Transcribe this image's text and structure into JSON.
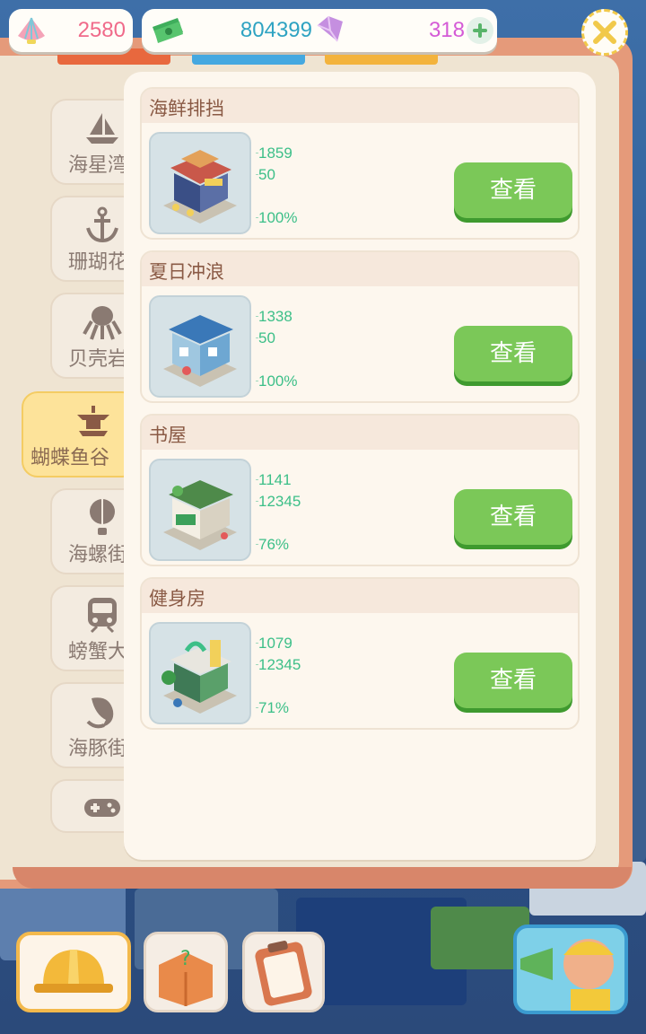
{
  "currencies": {
    "shells": "2580",
    "money": "804399",
    "gems": "318",
    "add_icon": "plus-icon",
    "close_icon": "close-x-icon"
  },
  "categories": [
    {
      "label": "海星湾",
      "icon": "sailboat-icon",
      "active": false
    },
    {
      "label": "珊瑚花",
      "icon": "anchor-icon",
      "active": false
    },
    {
      "label": "贝壳岩",
      "icon": "octopus-icon",
      "active": false
    },
    {
      "label": "蝴蝶鱼谷",
      "icon": "pagoda-icon",
      "active": true
    },
    {
      "label": "海螺街",
      "icon": "hot-air-balloon-icon",
      "active": false
    },
    {
      "label": "螃蟹大",
      "icon": "train-icon",
      "active": false
    },
    {
      "label": "海豚街",
      "icon": "dolphin-icon",
      "active": false
    },
    {
      "label": "",
      "icon": "gamepad-icon",
      "active": false
    }
  ],
  "buildings": [
    {
      "name": "海鲜排挡",
      "stat1": "1859",
      "stat2": "50",
      "percent": "100%",
      "button": "查看"
    },
    {
      "name": "夏日冲浪",
      "stat1": "1338",
      "stat2": "50",
      "percent": "100%",
      "button": "查看"
    },
    {
      "name": "书屋",
      "stat1": "1141",
      "stat2": "12345",
      "percent": "76%",
      "button": "查看"
    },
    {
      "name": "健身房",
      "stat1": "1079",
      "stat2": "12345",
      "percent": "71%",
      "button": "查看"
    }
  ],
  "dock": [
    {
      "icon": "hard-hat-icon"
    },
    {
      "icon": "mystery-box-icon"
    },
    {
      "icon": "clipboard-icon"
    },
    {
      "icon": "megaphone-character-icon"
    }
  ],
  "colors": {
    "accent_green": "#7bc858",
    "stat_green": "#3cbf88",
    "panel_orange": "#e59a7a",
    "active_tab": "#fde39a",
    "shells_pink": "#f06a8a",
    "money_teal": "#2ea3c2",
    "gems_purple": "#d45ad6"
  }
}
